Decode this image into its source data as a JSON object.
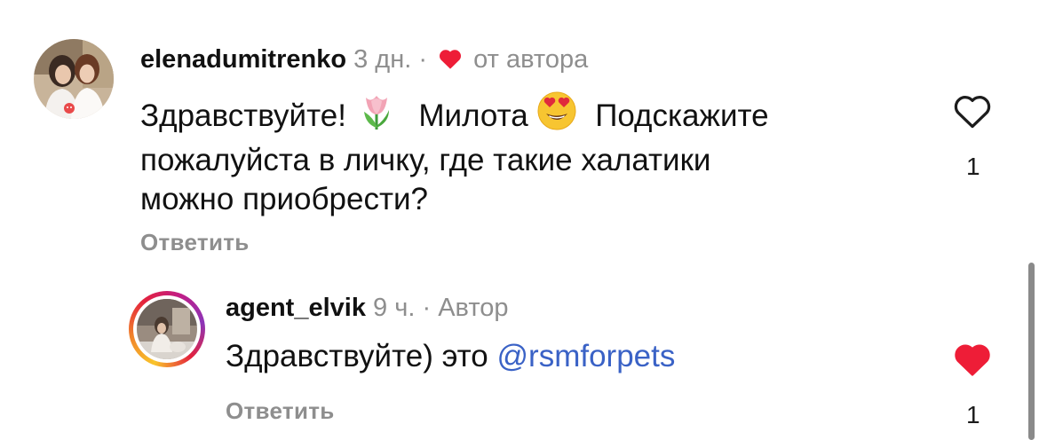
{
  "comments": [
    {
      "username": "elenadumitrenko",
      "time": "3 дн.",
      "separator": "·",
      "tag": "от автора",
      "text_1": "Здравствуйте!",
      "text_2": "Милота",
      "text_3": "Подскажите",
      "text_line2": "пожалуйста в личку, где такие халатики",
      "text_line3": "можно приобрести?",
      "reply_label": "Ответить",
      "like_count": "1",
      "liked": false
    },
    {
      "username": "agent_elvik",
      "time": "9 ч.",
      "separator": "·",
      "tag": "Автор",
      "text_prefix": "Здравствуйте) это",
      "mention": "@rsmforpets",
      "reply_label": "Ответить",
      "like_count": "1",
      "liked": true
    }
  ],
  "colors": {
    "heart_red": "#ee1d37",
    "mention_blue": "#3a62c6",
    "muted_gray": "#8e8e8e"
  },
  "icons": [
    "heart-outline-icon",
    "heart-filled-icon",
    "tulip-emoji",
    "heart-eyes-emoji"
  ]
}
